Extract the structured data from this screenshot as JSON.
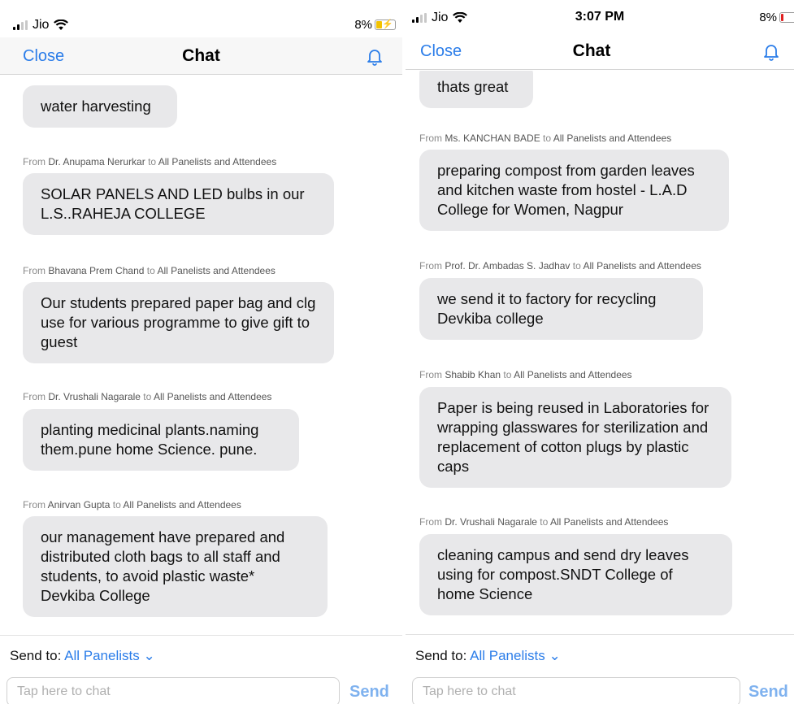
{
  "left": {
    "status": {
      "carrier": "Jio",
      "time": "",
      "battery_percent": "8%"
    },
    "nav": {
      "close_label": "Close",
      "title": "Chat"
    },
    "messages": [
      {
        "from": "",
        "to": "",
        "text": "water harvesting"
      },
      {
        "from": "Dr. Anupama Nerurkar",
        "to": "All Panelists and Attendees",
        "text": "SOLAR PANELS AND LED bulbs in our L.S..RAHEJA COLLEGE"
      },
      {
        "from": "Bhavana Prem Chand",
        "to": "All Panelists and Attendees",
        "text": "Our students  prepared  paper bag and clg use for various programme  to give gift to guest"
      },
      {
        "from": "Dr. Vrushali Nagarale",
        "to": "All Panelists and Attendees",
        "text": "planting medicinal plants.naming them.pune home Science. pune."
      },
      {
        "from": "Anirvan Gupta",
        "to": "All Panelists and Attendees",
        "text": "our management have prepared and distributed cloth bags to all staff and students, to avoid plastic waste* Devkiba College"
      }
    ],
    "footer": {
      "send_to_label": "Send to:",
      "send_to_value": "All Panelists",
      "input_placeholder": "Tap here to chat",
      "send_label": "Send"
    }
  },
  "right": {
    "status": {
      "carrier": "Jio",
      "time": "3:07 PM",
      "battery_percent": "8%"
    },
    "nav": {
      "close_label": "Close",
      "title": "Chat"
    },
    "messages": [
      {
        "from": "",
        "to": "",
        "text": "thats great"
      },
      {
        "from": "Ms. KANCHAN BADE",
        "to": "All Panelists and Attendees",
        "text": "preparing compost from garden leaves and kitchen waste from hostel - L.A.D College for Women, Nagpur"
      },
      {
        "from": "Prof. Dr. Ambadas S. Jadhav",
        "to": "All Panelists and Attendees",
        "text": "we send it to factory for recycling Devkiba college"
      },
      {
        "from": "Shabib Khan",
        "to": "All Panelists and Attendees",
        "text": "Paper is being reused in Laboratories for wrapping glasswares for sterilization and replacement of cotton plugs by plastic caps"
      },
      {
        "from": "Dr. Vrushali Nagarale",
        "to": "All Panelists and Attendees",
        "text": "cleaning campus and send dry leaves using for compost.SNDT College  of home Science"
      }
    ],
    "footer": {
      "send_to_label": "Send to:",
      "send_to_value": "All Panelists",
      "input_placeholder": "Tap here to chat",
      "send_label": "Send"
    }
  },
  "labels": {
    "from_word": "From",
    "to_word": "to"
  },
  "colors": {
    "accent": "#2b7de9",
    "bubble": "#e8e8ea",
    "battery_low": "#e02020",
    "battery_charging": "#f2c200",
    "send_disabled": "#7fb2ef"
  },
  "icons": [
    "signal-icon",
    "wifi-icon",
    "battery-icon",
    "bell-icon",
    "chevron-down-icon"
  ],
  "battery_level": 0.08
}
